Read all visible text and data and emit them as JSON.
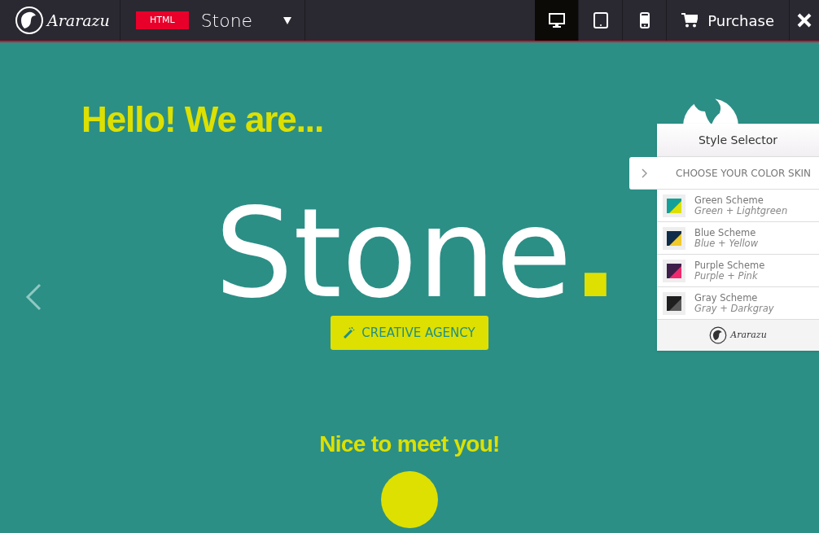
{
  "topbar": {
    "logo": "Ararazu",
    "badge": "HTML",
    "template": "Stone",
    "devices": [
      {
        "kind": "desktop",
        "selected": true
      },
      {
        "kind": "tablet",
        "selected": false
      },
      {
        "kind": "phone",
        "selected": false
      }
    ],
    "purchase": "Purchase"
  },
  "hero": {
    "greeting": "Hello! We are...",
    "title": "Stone",
    "title_dot": ".",
    "button": "CREATIVE AGENCY",
    "subheading": "Nice to meet you!"
  },
  "style_selector": {
    "title": "Style Selector",
    "header": "CHOOSE YOUR COLOR SKIN",
    "schemes": [
      {
        "name": "Green Scheme",
        "subtitle": "Green + Lightgreen",
        "swatch": [
          {
            "color": "#14a098"
          },
          {
            "color": "#dde000"
          }
        ]
      },
      {
        "name": "Blue Scheme",
        "subtitle": "Blue + Yellow",
        "swatch": [
          {
            "color": "#0f2b4a"
          },
          {
            "color": "#f0c92a"
          }
        ]
      },
      {
        "name": "Purple Scheme",
        "subtitle": "Purple + Pink",
        "swatch": [
          {
            "color": "#3d1f4a"
          },
          {
            "color": "#f0296e"
          }
        ]
      },
      {
        "name": "Gray Scheme",
        "subtitle": "Gray + Darkgray",
        "swatch": [
          {
            "color": "#1f1f1f"
          },
          {
            "color": "#5a5a5a"
          }
        ]
      }
    ],
    "footer_logo": "Ararazu"
  }
}
